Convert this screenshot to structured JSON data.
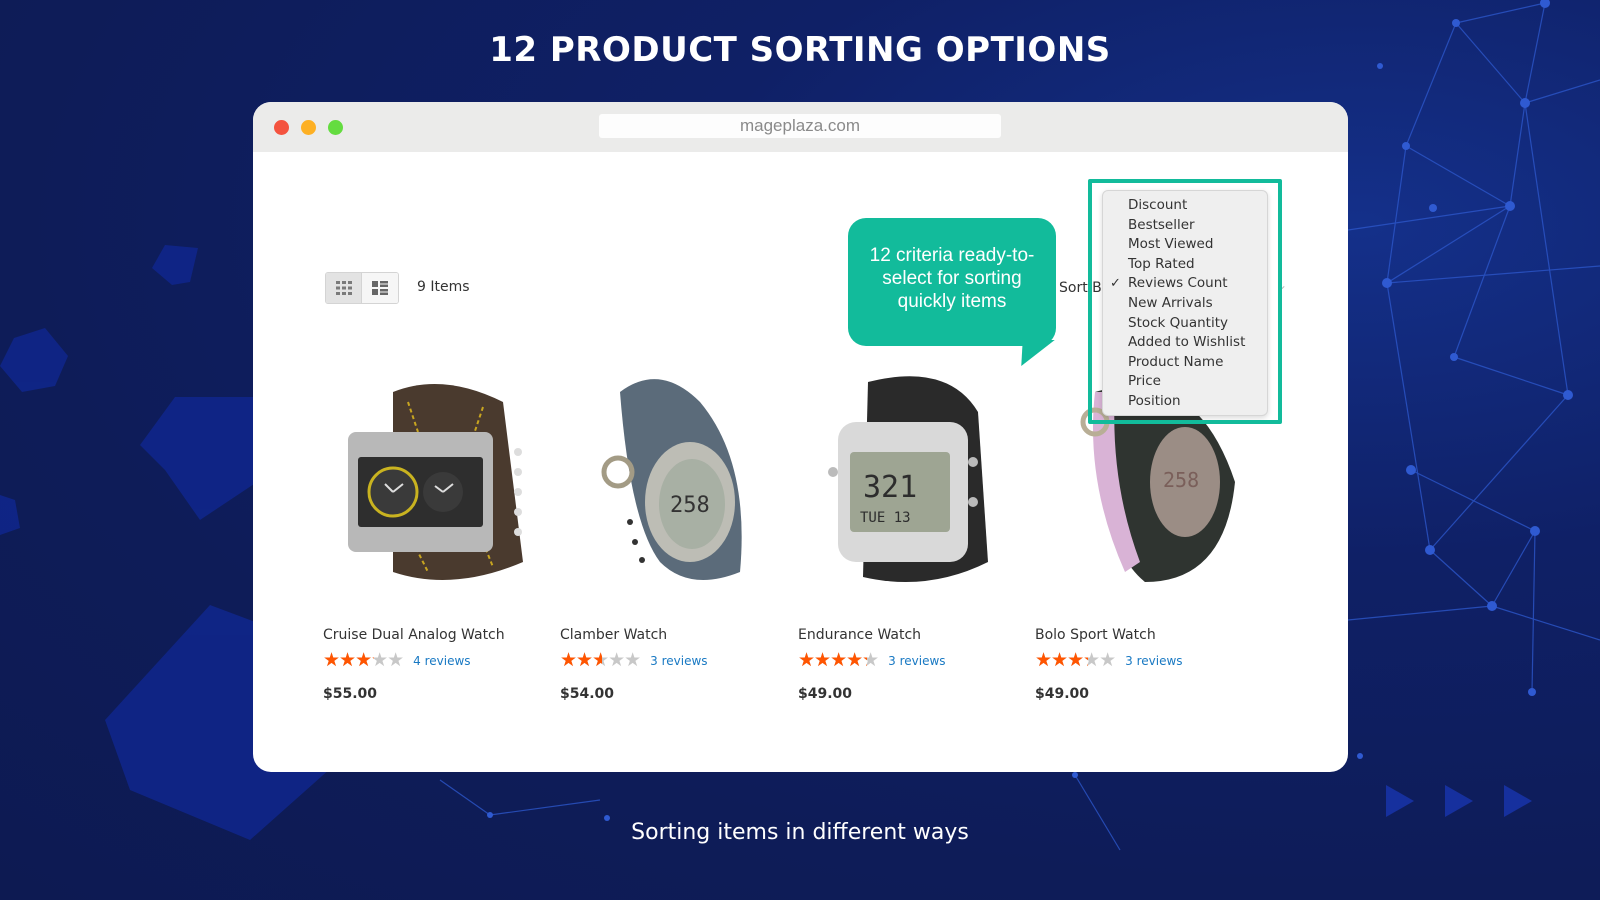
{
  "headline": "12 PRODUCT SORTING OPTIONS",
  "subline": "Sorting items in different ways",
  "browser": {
    "url": "mageplaza.com",
    "window_controls": [
      "close",
      "minimize",
      "maximize"
    ]
  },
  "toolbar": {
    "view_modes": [
      {
        "name": "grid-view",
        "icon": "grid-icon",
        "active": true
      },
      {
        "name": "list-view",
        "icon": "list-icon",
        "active": false
      }
    ],
    "items_count": "9 Items",
    "sort_label": "Sort By"
  },
  "callout": {
    "text": "12 criteria ready-to-select for sorting quickly items"
  },
  "sort_dropdown": {
    "selected": "Reviews Count",
    "options": [
      "Discount",
      "Bestseller",
      "Most Viewed",
      "Top Rated",
      "Reviews Count",
      "New Arrivals",
      "Stock Quantity",
      "Added to Wishlist",
      "Product Name",
      "Price",
      "Position"
    ]
  },
  "products": [
    {
      "name": "Cruise Dual Analog Watch",
      "rating": 3.2,
      "rating_max": 5,
      "reviews": "4 reviews",
      "price": "$55.00"
    },
    {
      "name": "Clamber Watch",
      "rating": 2.6,
      "rating_max": 5,
      "reviews": "3 reviews",
      "price": "$54.00"
    },
    {
      "name": "Endurance Watch",
      "rating": 4.3,
      "rating_max": 5,
      "reviews": "3 reviews",
      "price": "$49.00"
    },
    {
      "name": "Bolo Sport Watch",
      "rating": 3.3,
      "rating_max": 5,
      "reviews": "3 reviews",
      "price": "$49.00"
    }
  ],
  "colors": {
    "background": "#0e1c58",
    "accent": "#12bb9b",
    "star_filled": "#ff5501",
    "star_empty": "#c8c8c8",
    "link": "#1979c3"
  }
}
